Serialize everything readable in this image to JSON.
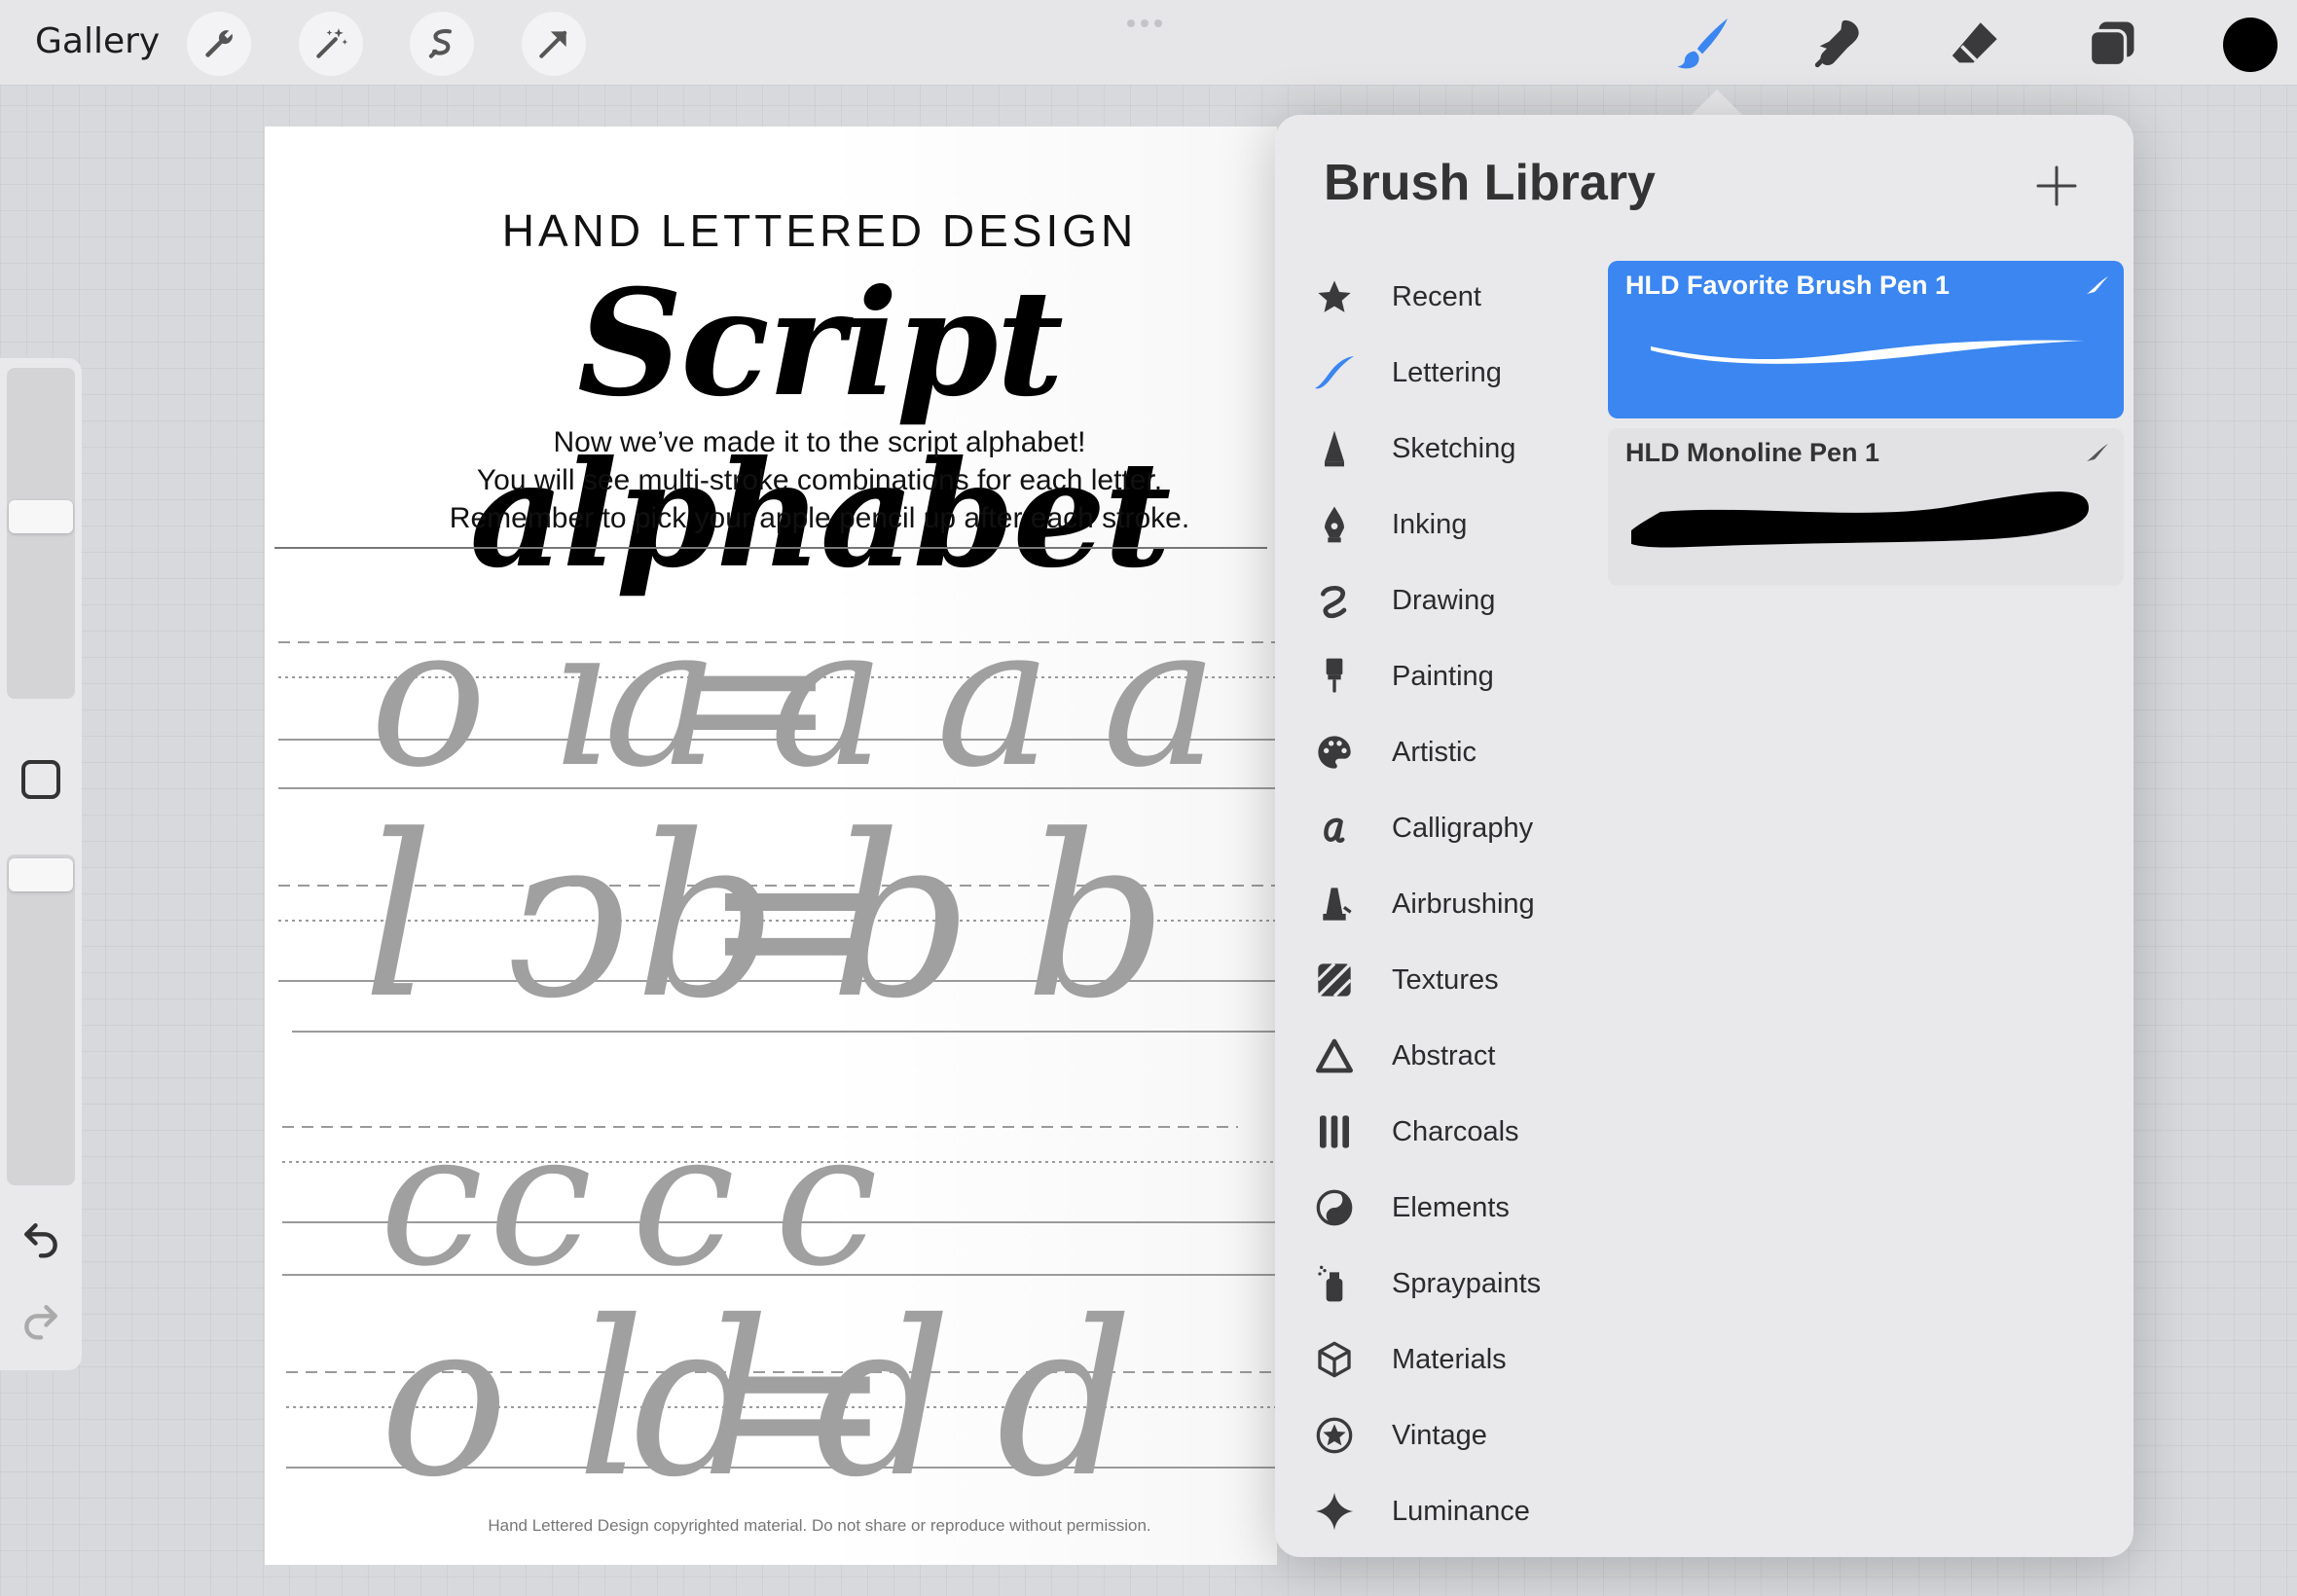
{
  "toolbar": {
    "gallery_label": "Gallery",
    "left_tools": [
      "wrench-icon",
      "magic-wand-icon",
      "selection-icon",
      "transform-arrow-icon"
    ],
    "right_tools": [
      "brush-icon",
      "smudge-icon",
      "eraser-icon",
      "layers-icon"
    ],
    "active_tool": "brush",
    "active_color": "#000000",
    "accent_color": "#3b86f0"
  },
  "sidebar": {
    "brush_size_level": 0.32,
    "opacity_level": 0.04,
    "controls": [
      "brush-size-slider",
      "modify-button",
      "opacity-slider",
      "undo-icon",
      "redo-icon"
    ]
  },
  "worksheet": {
    "title": "HAND LETTERED DESIGN",
    "script_title": "Script alphabet",
    "paragraph": [
      "Now we’ve made it to the script alphabet!",
      "You will see multi-stroke combinations for each letter.",
      "Remember to pick your apple pencil up after each stroke."
    ],
    "practice_rows": [
      {
        "strokes": "o ı =",
        "letters": "a a a a"
      },
      {
        "strokes": "l ↄ =",
        "letters": "b b b"
      },
      {
        "strokes": "c",
        "letters": "c c c"
      },
      {
        "strokes": "o l =",
        "letters": "d d d"
      }
    ],
    "footer": "Hand Lettered Design copyrighted material. Do not share or reproduce without permission."
  },
  "brush_library": {
    "title": "Brush Library",
    "add_icon": "plus-icon",
    "categories": [
      {
        "label": "Recent",
        "icon": "star-icon"
      },
      {
        "label": "Lettering",
        "icon": "lettering-stroke-icon"
      },
      {
        "label": "Sketching",
        "icon": "pencil-tip-icon"
      },
      {
        "label": "Inking",
        "icon": "pen-nib-icon"
      },
      {
        "label": "Drawing",
        "icon": "squiggle-icon"
      },
      {
        "label": "Painting",
        "icon": "paint-brush-icon"
      },
      {
        "label": "Artistic",
        "icon": "palette-icon"
      },
      {
        "label": "Calligraphy",
        "icon": "calligraphy-a-icon"
      },
      {
        "label": "Airbrushing",
        "icon": "airbrush-icon"
      },
      {
        "label": "Textures",
        "icon": "texture-icon"
      },
      {
        "label": "Abstract",
        "icon": "triangle-icon"
      },
      {
        "label": "Charcoals",
        "icon": "charcoal-icon"
      },
      {
        "label": "Elements",
        "icon": "yin-yang-icon"
      },
      {
        "label": "Spraypaints",
        "icon": "spray-can-icon"
      },
      {
        "label": "Materials",
        "icon": "cube-icon"
      },
      {
        "label": "Vintage",
        "icon": "vintage-star-icon"
      },
      {
        "label": "Luminance",
        "icon": "sparkle-icon"
      }
    ],
    "selected_category": "Lettering",
    "brushes": [
      {
        "name": "HLD Favorite Brush Pen 1",
        "selected": true
      },
      {
        "name": "HLD Monoline Pen 1",
        "selected": false
      }
    ]
  }
}
